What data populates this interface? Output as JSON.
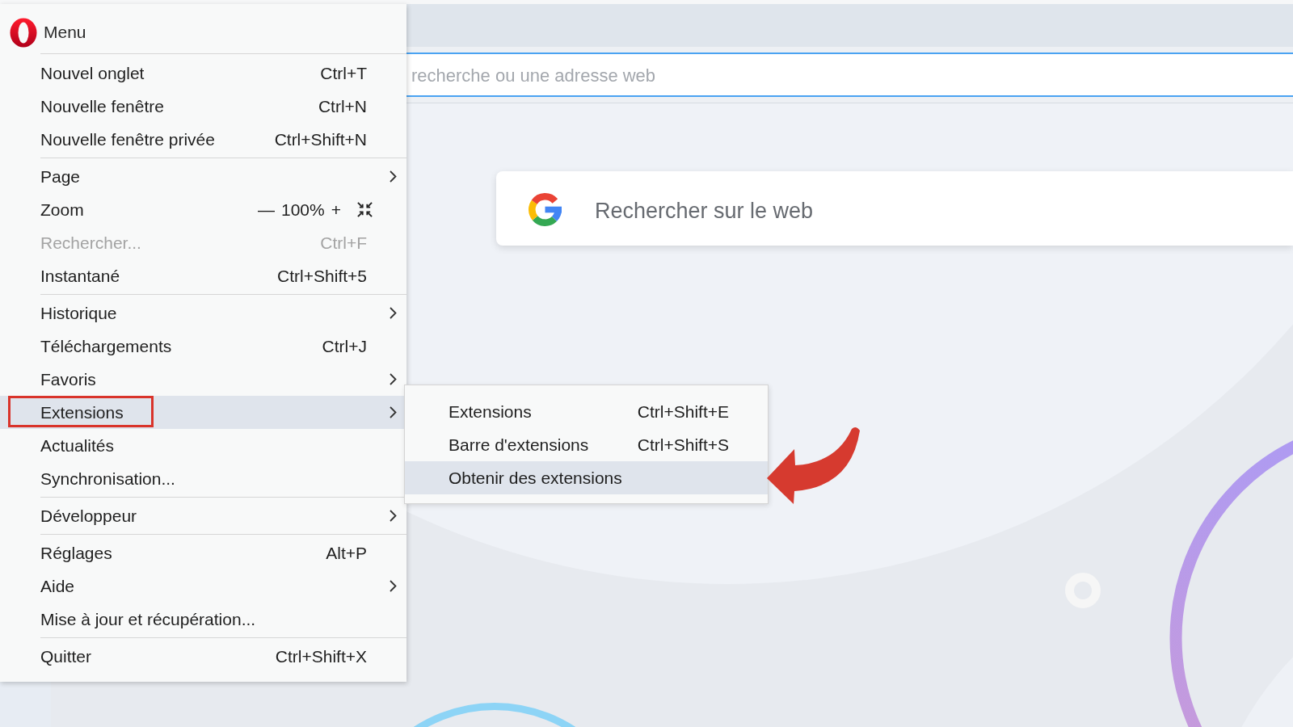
{
  "browser": {
    "address_bar": {
      "placeholder": "recherche ou une adresse web"
    },
    "search_box": {
      "placeholder": "Rechercher sur le web"
    }
  },
  "menu": {
    "title": "Menu",
    "groups": [
      [
        {
          "kind": "item",
          "label": "Nouvel onglet",
          "shortcut": "Ctrl+T",
          "submenu": false,
          "disabled": false,
          "selected": false,
          "outlined": false
        },
        {
          "kind": "item",
          "label": "Nouvelle fenêtre",
          "shortcut": "Ctrl+N",
          "submenu": false,
          "disabled": false,
          "selected": false,
          "outlined": false
        },
        {
          "kind": "item",
          "label": "Nouvelle fenêtre privée",
          "shortcut": "Ctrl+Shift+N",
          "submenu": false,
          "disabled": false,
          "selected": false,
          "outlined": false
        }
      ],
      [
        {
          "kind": "item",
          "label": "Page",
          "submenu": true,
          "disabled": false,
          "selected": false,
          "outlined": false
        },
        {
          "kind": "zoom",
          "label": "Zoom",
          "zoom_out": "—",
          "zoom_value": "100%",
          "zoom_in": "+",
          "submenu": false,
          "disabled": false,
          "selected": false,
          "outlined": false
        },
        {
          "kind": "item",
          "label": "Rechercher...",
          "shortcut": "Ctrl+F",
          "submenu": false,
          "disabled": true,
          "selected": false,
          "outlined": false
        },
        {
          "kind": "item",
          "label": "Instantané",
          "shortcut": "Ctrl+Shift+5",
          "submenu": false,
          "disabled": false,
          "selected": false,
          "outlined": false
        }
      ],
      [
        {
          "kind": "item",
          "label": "Historique",
          "submenu": true,
          "disabled": false,
          "selected": false,
          "outlined": false
        },
        {
          "kind": "item",
          "label": "Téléchargements",
          "shortcut": "Ctrl+J",
          "submenu": false,
          "disabled": false,
          "selected": false,
          "outlined": false
        },
        {
          "kind": "item",
          "label": "Favoris",
          "submenu": true,
          "disabled": false,
          "selected": false,
          "outlined": false
        },
        {
          "kind": "item",
          "label": "Extensions",
          "submenu": true,
          "disabled": false,
          "selected": true,
          "outlined": true
        },
        {
          "kind": "item",
          "label": "Actualités",
          "submenu": false,
          "disabled": false,
          "selected": false,
          "outlined": false
        },
        {
          "kind": "item",
          "label": "Synchronisation...",
          "submenu": false,
          "disabled": false,
          "selected": false,
          "outlined": false
        }
      ],
      [
        {
          "kind": "item",
          "label": "Développeur",
          "submenu": true,
          "disabled": false,
          "selected": false,
          "outlined": false
        }
      ],
      [
        {
          "kind": "item",
          "label": "Réglages",
          "shortcut": "Alt+P",
          "submenu": false,
          "disabled": false,
          "selected": false,
          "outlined": false
        },
        {
          "kind": "item",
          "label": "Aide",
          "submenu": true,
          "disabled": false,
          "selected": false,
          "outlined": false
        },
        {
          "kind": "item",
          "label": "Mise à jour et récupération...",
          "submenu": false,
          "disabled": false,
          "selected": false,
          "outlined": false
        }
      ],
      [
        {
          "kind": "item",
          "label": "Quitter",
          "shortcut": "Ctrl+Shift+X",
          "submenu": false,
          "disabled": false,
          "selected": false,
          "outlined": false
        }
      ]
    ]
  },
  "submenu": {
    "items": [
      {
        "label": "Extensions",
        "shortcut": "Ctrl+Shift+E",
        "selected": false,
        "pointed": false
      },
      {
        "label": "Barre d'extensions",
        "shortcut": "Ctrl+Shift+S",
        "selected": false,
        "pointed": false
      },
      {
        "label": "Obtenir des extensions",
        "selected": true,
        "pointed": true
      }
    ]
  }
}
